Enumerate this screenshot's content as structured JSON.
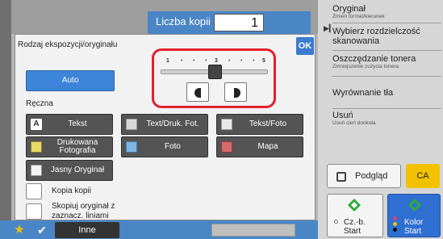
{
  "header": {
    "copies_label": "Liczba kopii",
    "copies_value": "1"
  },
  "right_panel": {
    "items": [
      {
        "title": "Oryginał",
        "subtitle": "Zmień format/kierunek"
      },
      {
        "title": "Wybierz rozdzielczość skanowania",
        "subtitle": ""
      },
      {
        "title": "Oszczędzanie tonera",
        "subtitle": "Zmniejszenie zużycia tonera"
      },
      {
        "title": "Wyrównanie tła",
        "subtitle": ""
      },
      {
        "title": "Usuń",
        "subtitle": "Usuń cień dookoła"
      }
    ],
    "preview_label": "Podgląd",
    "ca_label": "CA",
    "bw_start_line1": "Cz.-b.",
    "bw_start_line2": "Start",
    "color_start_line1": "Kolor",
    "color_start_line2": "Start"
  },
  "dialog": {
    "title": "Rodzaj ekspozycji/oryginału",
    "ok_label": "OK",
    "auto_label": "Auto",
    "manual_label": "Ręczna",
    "exposure": {
      "scale": [
        "1",
        "3",
        "5"
      ],
      "level": 3,
      "min": 1,
      "max": 5
    },
    "types": [
      {
        "label": "Tekst"
      },
      {
        "label": "Text/Druk. Fot."
      },
      {
        "label": "Tekst/Foto"
      },
      {
        "label": "Drukowana Fotografia"
      },
      {
        "label": "Foto"
      },
      {
        "label": "Mapa"
      },
      {
        "label": "Jasny Oryginał"
      }
    ],
    "checkboxes": [
      {
        "label": "Kopia kopii"
      },
      {
        "label": "Skopiuj oryginał z zaznacz. liniami"
      }
    ]
  },
  "bottom": {
    "other_label": "Inne"
  },
  "colors": {
    "accent_blue": "#3c85d8",
    "ok_blue": "#3b7bd0",
    "highlight_red": "#e4202c",
    "ca_yellow": "#f2c200",
    "start_green": "#2eaa3a",
    "type_button_gray": "#545454"
  }
}
